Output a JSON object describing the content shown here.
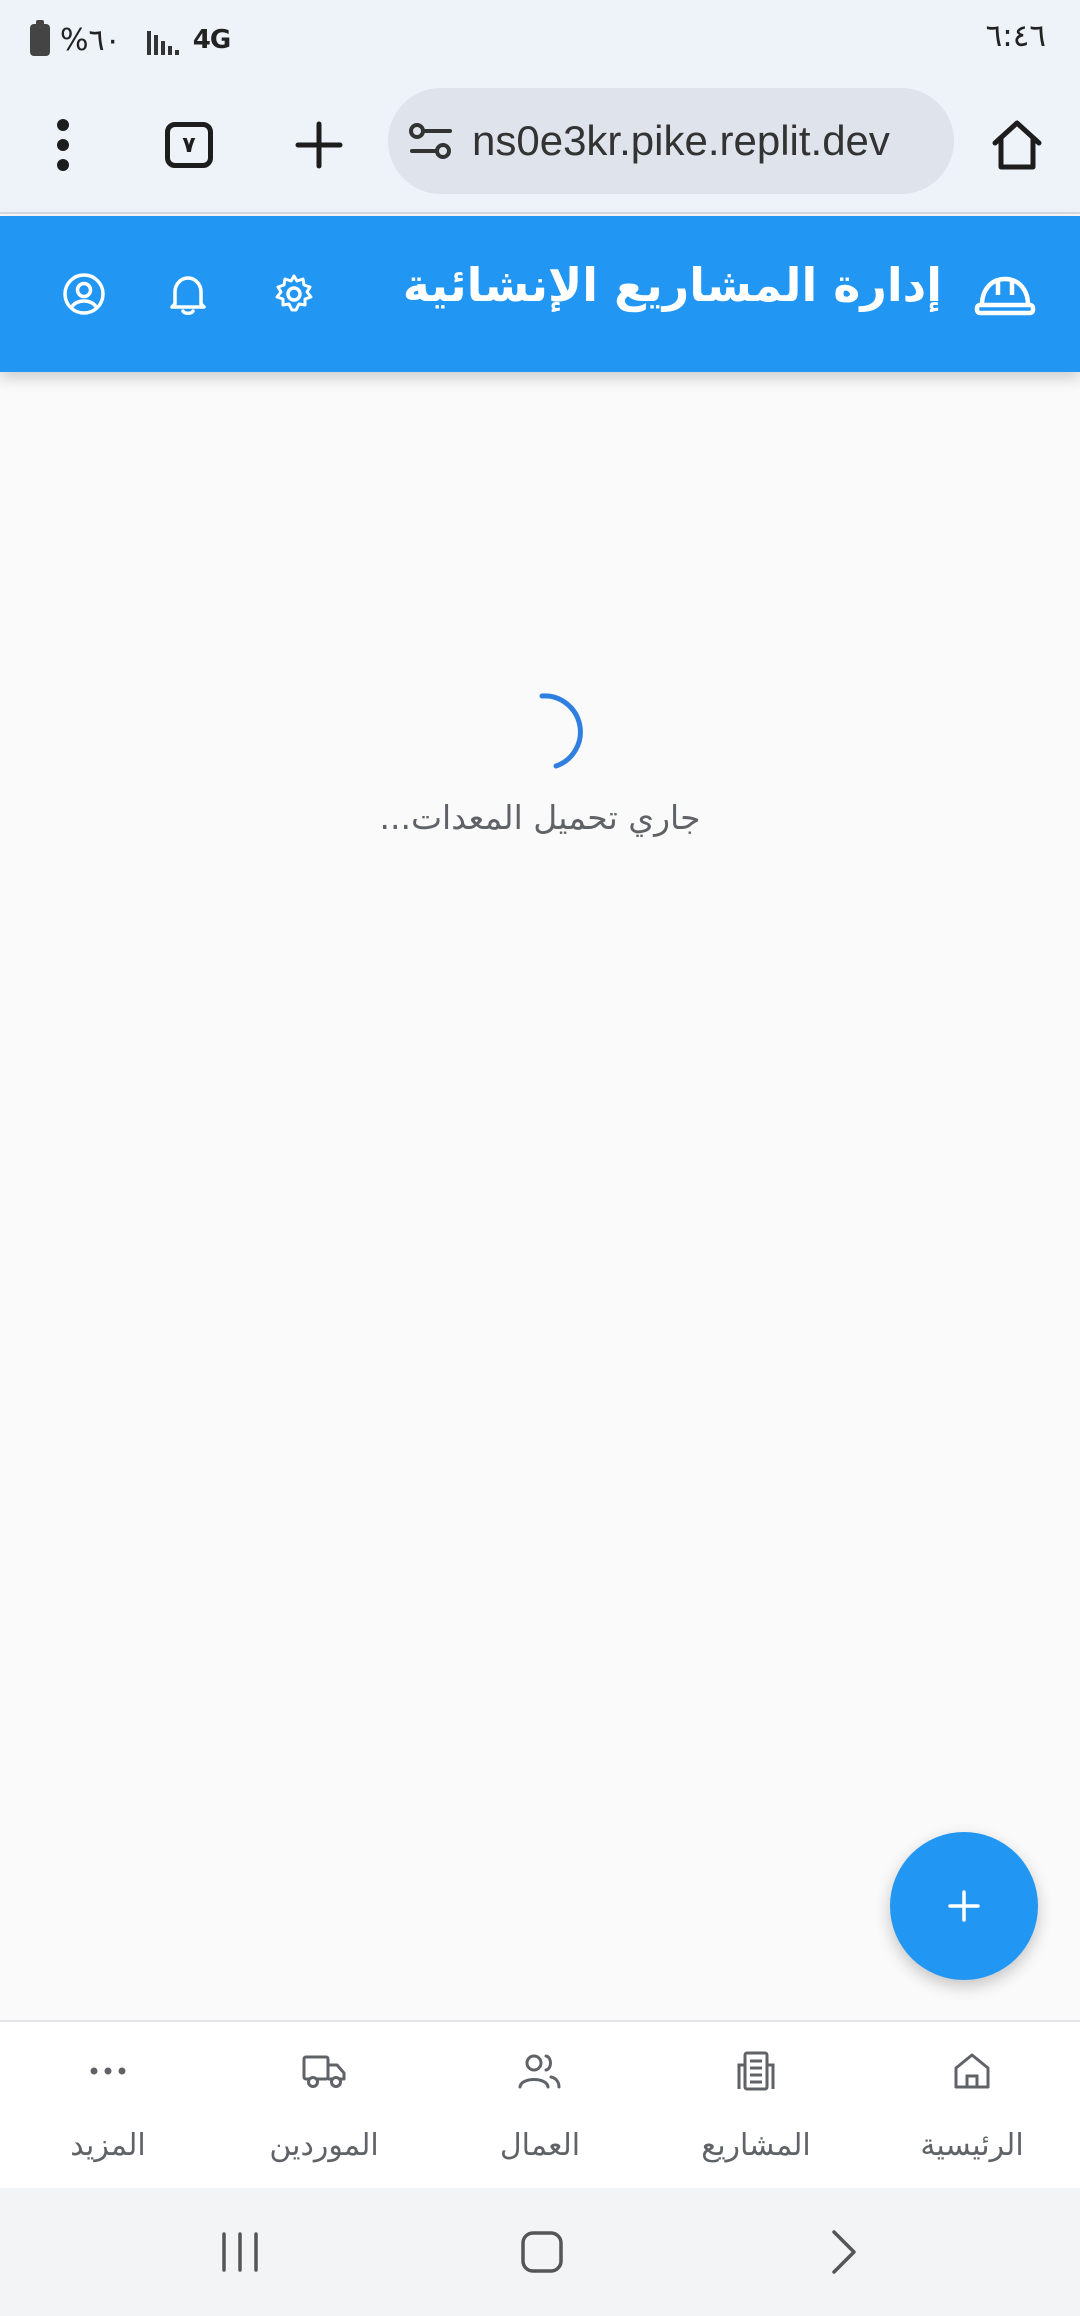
{
  "status_bar": {
    "time": "٦:٤٦",
    "battery": "%٦٠",
    "network": "4G"
  },
  "browser": {
    "url": "ns0e3kr.pike.replit.dev",
    "tab_count": "٧"
  },
  "header": {
    "title": "إدارة المشاريع الإنشائية",
    "icons": [
      "hard-hat-icon",
      "gear-icon",
      "bell-icon",
      "user-circle-icon"
    ]
  },
  "main": {
    "loading_text": "جاري تحميل المعدات..."
  },
  "fab": {
    "label": "+"
  },
  "bottom_nav": {
    "items": [
      {
        "label": "الرئيسية",
        "icon": "home-icon"
      },
      {
        "label": "المشاريع",
        "icon": "building-icon"
      },
      {
        "label": "العمال",
        "icon": "users-icon"
      },
      {
        "label": "الموردين",
        "icon": "truck-icon"
      },
      {
        "label": "المزيد",
        "icon": "more-icon"
      }
    ]
  },
  "colors": {
    "primary": "#2196f3",
    "background": "#fafafa",
    "browser_bar": "#eef2f9",
    "nav_text": "#5f6368"
  }
}
